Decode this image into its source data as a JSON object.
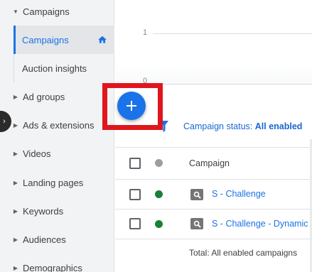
{
  "sidebar": {
    "items": [
      {
        "label": "Campaigns",
        "expanded": true
      },
      {
        "label": "Campaigns",
        "active": true
      },
      {
        "label": "Auction insights"
      },
      {
        "label": "Ad groups"
      },
      {
        "label": "Ads & extensions"
      },
      {
        "label": "Videos"
      },
      {
        "label": "Landing pages"
      },
      {
        "label": "Keywords"
      },
      {
        "label": "Audiences"
      },
      {
        "label": "Demographics"
      }
    ]
  },
  "chart": {
    "y_ticks": [
      "1",
      "0"
    ]
  },
  "filter": {
    "prefix": "Campaign status: ",
    "value": "All enabled"
  },
  "table": {
    "header": "Campaign",
    "rows": [
      {
        "name": "S - Challenge",
        "status_color": "#188038"
      },
      {
        "name": "S - Challenge - Dynamic",
        "status_color": "#188038"
      }
    ],
    "total": "Total: All enabled campaigns"
  },
  "colors": {
    "accent": "#1a73e8",
    "highlight": "#e0161d",
    "enabled": "#188038"
  },
  "icons": {
    "fab": "plus-icon",
    "home": "home-icon",
    "filter": "filter-icon",
    "toggle": "chevron-right-icon"
  }
}
